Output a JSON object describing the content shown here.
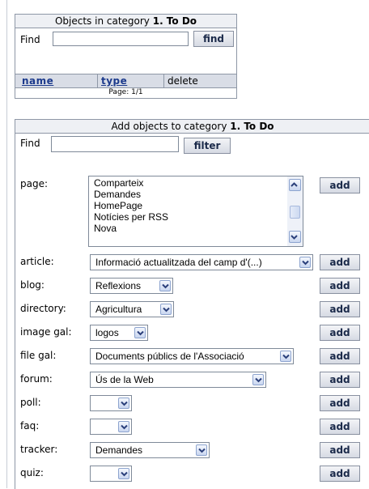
{
  "existing": {
    "header_prefix": "Objects in category ",
    "category": "1. To Do",
    "find_label": "Find",
    "find_value": "",
    "find_button": "find",
    "columns": {
      "name": "name",
      "type": "type",
      "delete": "delete"
    },
    "page_info": "Page: 1/1"
  },
  "add": {
    "header_prefix": "Add objects to category ",
    "category": "1. To Do",
    "find_label": "Find",
    "find_value": "",
    "filter_button": "filter",
    "add_label": "add",
    "page": {
      "label": "page:",
      "options": [
        "Comparteix",
        "Demandes",
        "HomePage",
        "Notícies per RSS",
        "Nova"
      ]
    },
    "article": {
      "label": "article:",
      "value": "Informació actualitzada del camp d'(...)"
    },
    "blog": {
      "label": "blog:",
      "value": "Reflexions"
    },
    "directory": {
      "label": "directory:",
      "value": "Agricultura"
    },
    "image_gal": {
      "label": "image gal:",
      "value": "logos"
    },
    "file_gal": {
      "label": "file gal:",
      "value": "Documents públics de l'Associació"
    },
    "forum": {
      "label": "forum:",
      "value": "Ús de la Web"
    },
    "poll": {
      "label": "poll:",
      "value": ""
    },
    "faq": {
      "label": "faq:",
      "value": ""
    },
    "tracker": {
      "label": "tracker:",
      "value": "Demandes"
    },
    "quiz": {
      "label": "quiz:",
      "value": ""
    }
  },
  "icons": {
    "dropdown": "chevron-down-icon",
    "scroll_up": "chevron-up-icon",
    "scroll_down": "chevron-down-icon",
    "scroll_thumb": "grip-icon"
  },
  "colors": {
    "border": "#8e97a6",
    "link": "#1c3a8c",
    "header_bg": "#eef0f4",
    "column_header_bg": "#d9dde6",
    "arrow_button": "#c9d6f0"
  }
}
